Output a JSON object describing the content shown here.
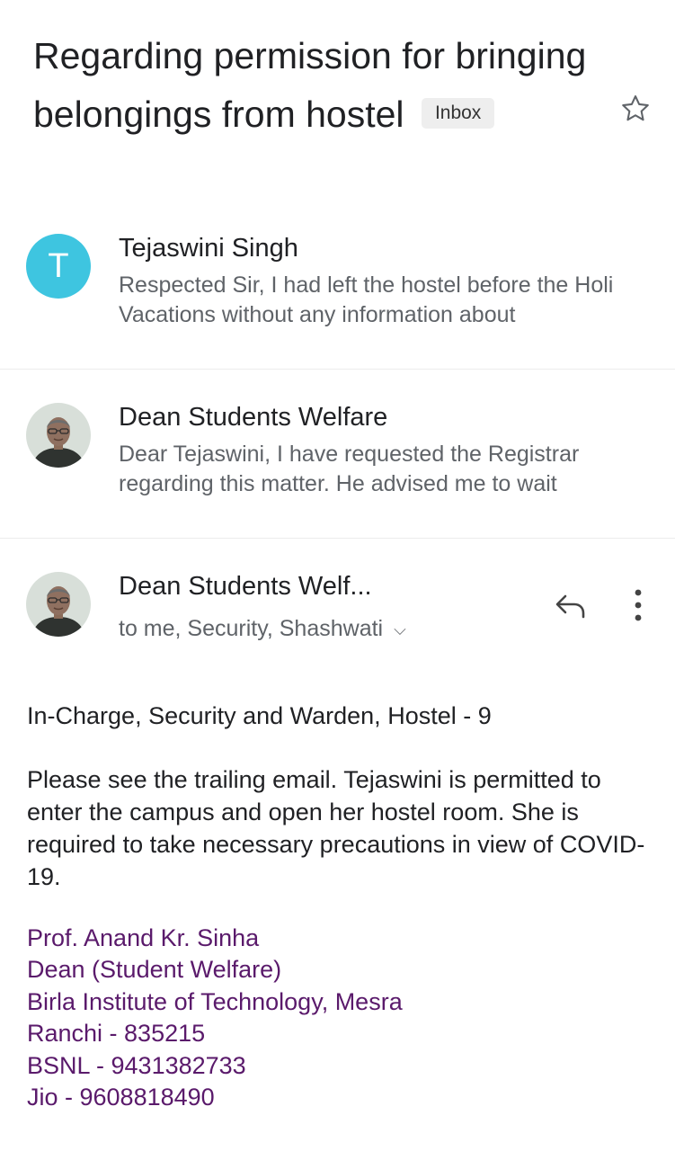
{
  "email": {
    "subject": "Regarding permission for bringing belongings from hostel",
    "label": "Inbox",
    "star_icon": "star-outline-icon"
  },
  "thread": [
    {
      "sender": "Tejaswini Singh",
      "avatar_letter": "T",
      "avatar_color": "#3ec5e0",
      "snippet": "Respected Sir, I had left the hostel before the Holi Vacations without any information about"
    },
    {
      "sender": "Dean Students Welfare",
      "avatar": "profile-photo",
      "snippet": "Dear Tejaswini, I have requested the Registrar regarding this matter. He advised me to wait"
    }
  ],
  "open_message": {
    "sender": "Dean Students Welf...",
    "recipients": "to me, Security, Shashwati",
    "actions": [
      "reply-icon",
      "more-vert-icon"
    ],
    "greeting": "In-Charge, Security and Warden, Hostel - 9",
    "body": "Please see the trailing email. Tejaswini is permitted to enter the campus and open her hostel room. She is required to take necessary precautions in view of COVID-19.",
    "signature": [
      "Prof. Anand Kr. Sinha",
      "Dean (Student Welfare)",
      "Birla Institute of Technology, Mesra",
      "Ranchi - 835215",
      "BSNL - 9431382733",
      "Jio - 9608818490"
    ],
    "signature_color": "#5a1a6b"
  }
}
